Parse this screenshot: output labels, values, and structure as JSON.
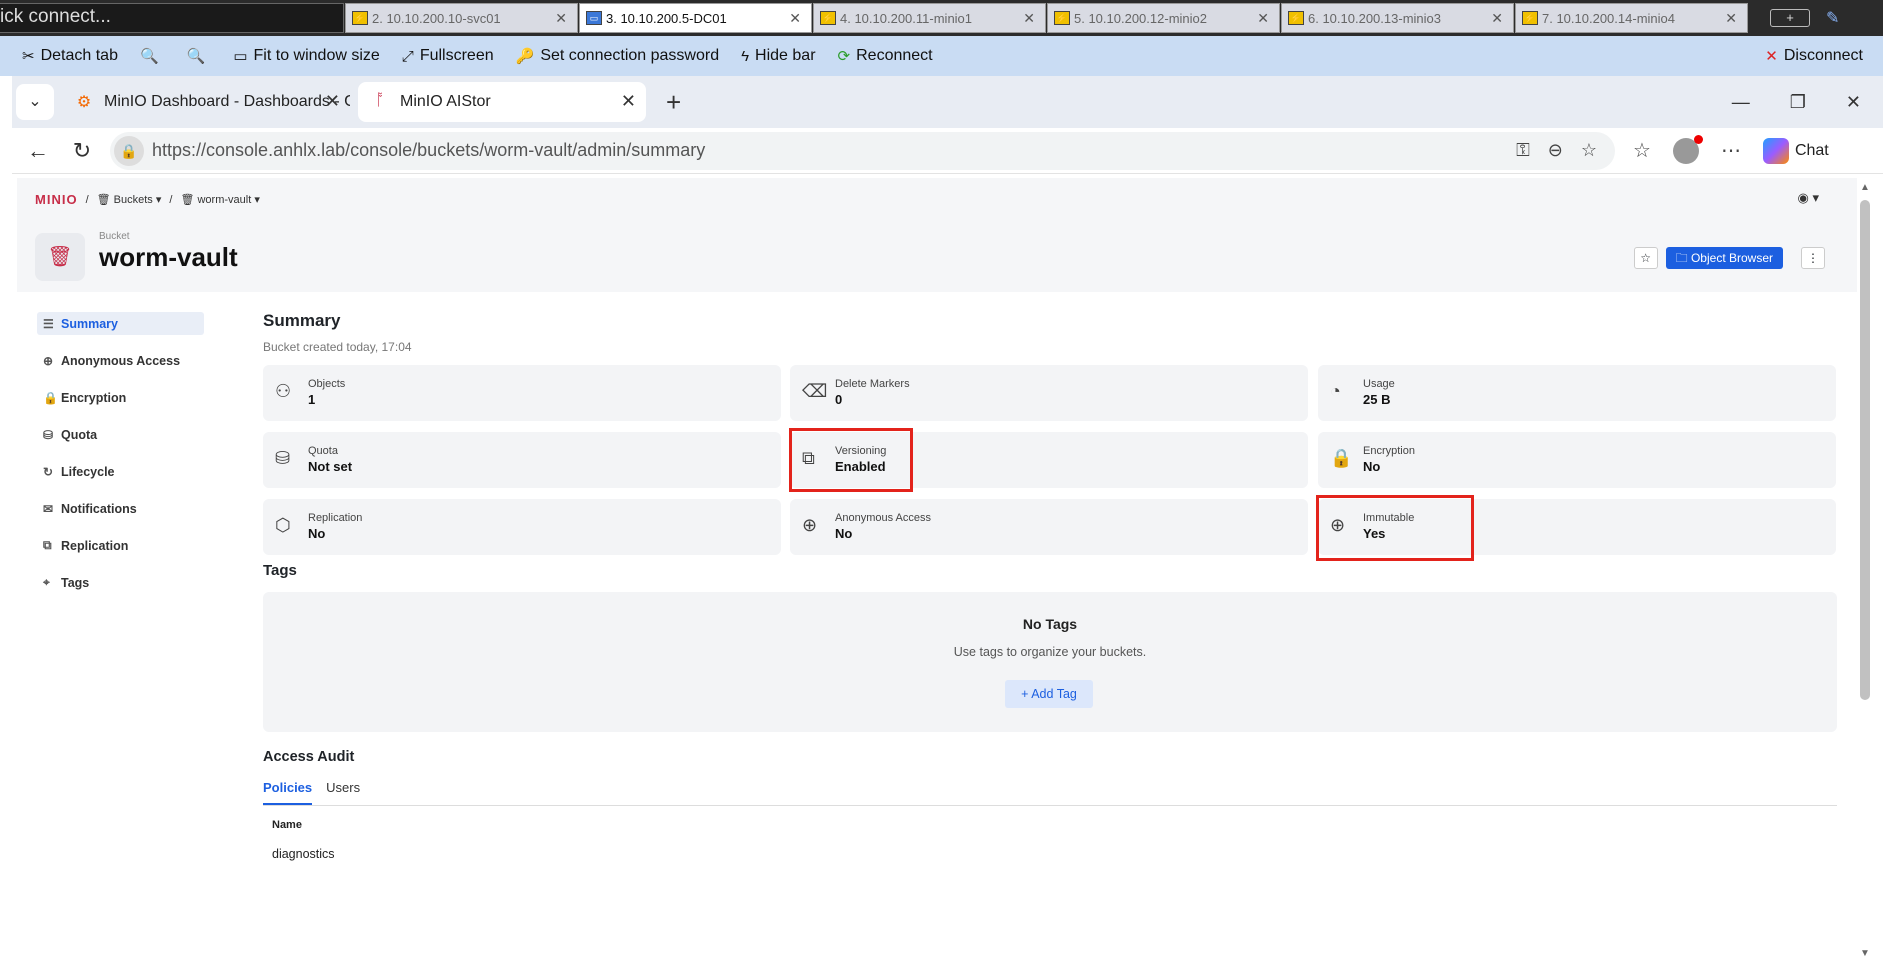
{
  "rdp": {
    "quick_connect": "ick connect...",
    "tabs": [
      {
        "label": "2. 10.10.200.10-svc01",
        "active": false
      },
      {
        "label": "3. 10.10.200.5-DC01",
        "active": true
      },
      {
        "label": "4. 10.10.200.11-minio1",
        "active": false
      },
      {
        "label": "5. 10.10.200.12-minio2",
        "active": false
      },
      {
        "label": "6. 10.10.200.13-minio3",
        "active": false
      },
      {
        "label": "7. 10.10.200.14-minio4",
        "active": false
      }
    ],
    "toolbar": {
      "detach": "Detach tab",
      "fit": "Fit to window size",
      "fullscreen": "Fullscreen",
      "set_password": "Set connection password",
      "hide_bar": "Hide bar",
      "reconnect": "Reconnect",
      "disconnect": "Disconnect"
    }
  },
  "browser": {
    "tabs": [
      {
        "label": "MinIO Dashboard - Dashboards - G"
      },
      {
        "label": "MinIO AIStor"
      }
    ],
    "url": "https://console.anhlx.lab/console/buckets/worm-vault/admin/summary",
    "chat_label": "Chat"
  },
  "app": {
    "logo": "MINIO",
    "breadcrumb": {
      "sep": "/",
      "buckets": "Buckets",
      "bucket": "worm-vault"
    },
    "bucket_label": "Bucket",
    "bucket_name": "worm-vault",
    "object_browser": "Object Browser"
  },
  "sidebar": {
    "items": [
      {
        "label": "Summary",
        "icon": "list-icon"
      },
      {
        "label": "Anonymous Access",
        "icon": "globe-icon"
      },
      {
        "label": "Encryption",
        "icon": "lock-icon"
      },
      {
        "label": "Quota",
        "icon": "quota-icon"
      },
      {
        "label": "Lifecycle",
        "icon": "lifecycle-icon"
      },
      {
        "label": "Notifications",
        "icon": "notification-icon"
      },
      {
        "label": "Replication",
        "icon": "replication-icon"
      },
      {
        "label": "Tags",
        "icon": "tag-icon"
      }
    ]
  },
  "summary": {
    "title": "Summary",
    "created": "Bucket created today, 17:04",
    "cards": [
      {
        "label": "Objects",
        "value": "1"
      },
      {
        "label": "Delete Markers",
        "value": "0"
      },
      {
        "label": "Usage",
        "value": "25 B"
      },
      {
        "label": "Quota",
        "value": "Not set"
      },
      {
        "label": "Versioning",
        "value": "Enabled"
      },
      {
        "label": "Encryption",
        "value": "No"
      },
      {
        "label": "Replication",
        "value": "No"
      },
      {
        "label": "Anonymous Access",
        "value": "No"
      },
      {
        "label": "Immutable",
        "value": "Yes"
      }
    ],
    "highlight_color": "#e3231b"
  },
  "tags": {
    "title": "Tags",
    "empty_title": "No Tags",
    "empty_hint": "Use tags to organize your buckets.",
    "add": "+ Add Tag"
  },
  "audit": {
    "title": "Access Audit",
    "tabs": [
      "Policies",
      "Users"
    ],
    "column": "Name",
    "rows": [
      "diagnostics"
    ]
  }
}
